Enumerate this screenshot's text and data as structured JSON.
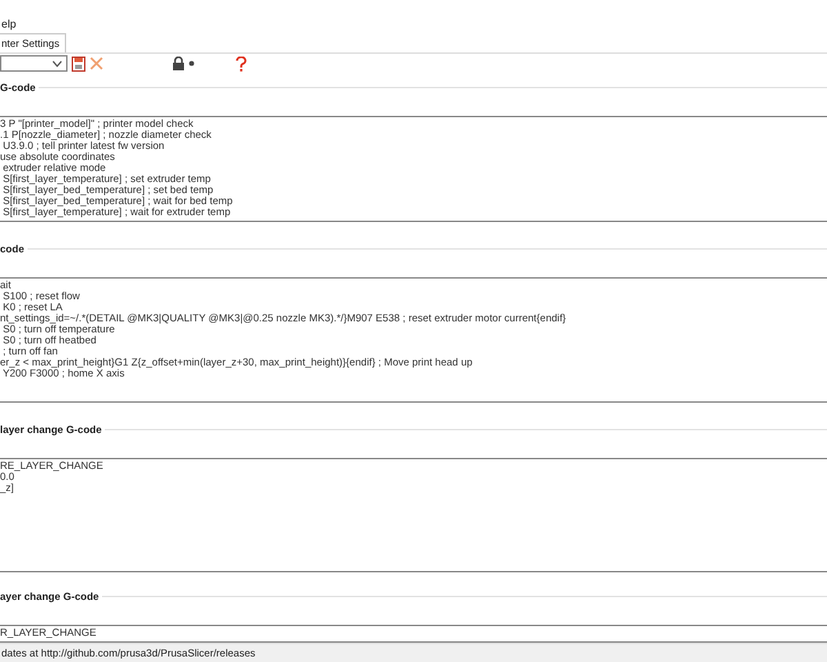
{
  "menu": [
    "elp"
  ],
  "tabs": [
    {
      "label": "nter Settings",
      "selected": true
    }
  ],
  "sections": [
    {
      "title": "G-code",
      "lines": [
        "3 P \"[printer_model]\" ; printer model check",
        ".1 P[nozzle_diameter] ; nozzle diameter check",
        " U3.9.0 ; tell printer latest fw version",
        "use absolute coordinates",
        " extruder relative mode",
        " S[first_layer_temperature] ; set extruder temp",
        " S[first_layer_bed_temperature] ; set bed temp",
        " S[first_layer_bed_temperature] ; wait for bed temp",
        " S[first_layer_temperature] ; wait for extruder temp"
      ]
    },
    {
      "title": "code",
      "lines": [
        "ait",
        " S100 ; reset flow",
        " K0 ; reset LA",
        "nt_settings_id=~/.*(DETAIL @MK3|QUALITY @MK3|@0.25 nozzle MK3).*/}M907 E538 ; reset extruder motor current{endif}",
        " S0 ; turn off temperature",
        " S0 ; turn off heatbed",
        " ; turn off fan",
        "er_z < max_print_height}G1 Z{z_offset+min(layer_z+30, max_print_height)}{endif} ; Move print head up",
        " Y200 F3000 ; home X axis"
      ]
    },
    {
      "title": "layer change G-code",
      "lines": [
        "RE_LAYER_CHANGE",
        "0.0",
        "_z]"
      ]
    },
    {
      "title": "ayer change G-code",
      "lines": [
        "R_LAYER_CHANGE"
      ]
    }
  ],
  "status_bar": "dates at http://github.com/prusa3d/PrusaSlicer/releases"
}
